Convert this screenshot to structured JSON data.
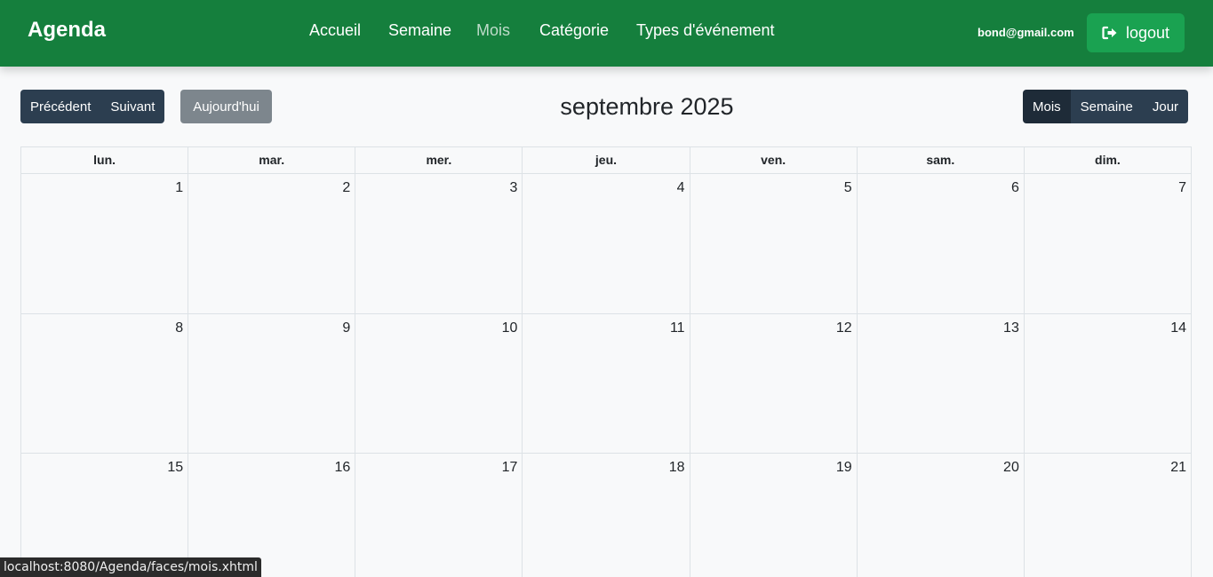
{
  "app": {
    "brand": "Agenda"
  },
  "nav": {
    "items": [
      {
        "label": "Accueil",
        "active": false
      },
      {
        "label": "Semaine",
        "active": false
      },
      {
        "label": "Mois",
        "active": true
      },
      {
        "label": "Catégorie",
        "active": false
      },
      {
        "label": "Types d'événement",
        "active": false
      }
    ]
  },
  "user": {
    "email": "bond@gmail.com",
    "logout_label": "logout",
    "logout_icon": "sign-out-icon"
  },
  "toolbar": {
    "prev_label": "Précédent",
    "next_label": "Suivant",
    "today_label": "Aujourd'hui",
    "title": "septembre 2025",
    "views": [
      {
        "label": "Mois",
        "active": true
      },
      {
        "label": "Semaine",
        "active": false
      },
      {
        "label": "Jour",
        "active": false
      }
    ]
  },
  "calendar": {
    "weekdays": [
      "lun.",
      "mar.",
      "mer.",
      "jeu.",
      "ven.",
      "sam.",
      "dim."
    ],
    "weeks": [
      [
        "1",
        "2",
        "3",
        "4",
        "5",
        "6",
        "7"
      ],
      [
        "8",
        "9",
        "10",
        "11",
        "12",
        "13",
        "14"
      ],
      [
        "15",
        "16",
        "17",
        "18",
        "19",
        "20",
        "21"
      ]
    ]
  },
  "status_bar": {
    "url": "localhost:8080/Agenda/faces/mois.xhtml"
  },
  "colors": {
    "navbar": "#157f3d",
    "logout_button": "#1aa251",
    "toolbar_button": "#2c3e50",
    "today_button": "#7d868d",
    "background": "#f8f9fa"
  }
}
